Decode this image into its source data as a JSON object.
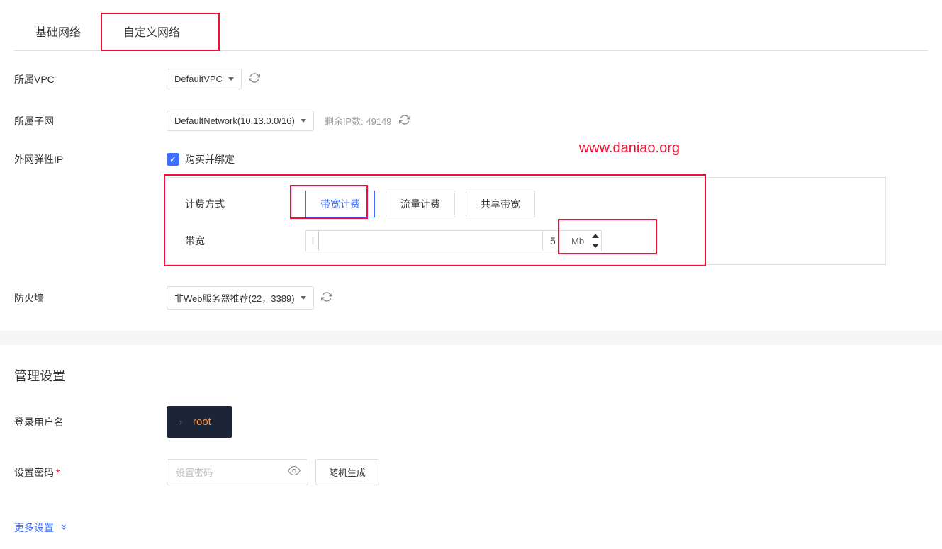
{
  "tabs": {
    "basic": "基础网络",
    "custom": "自定义网络"
  },
  "vpc": {
    "label": "所属VPC",
    "value": "DefaultVPC"
  },
  "subnet": {
    "label": "所属子网",
    "value": "DefaultNetwork(10.13.0.0/16)",
    "remaining_label": "剩余IP数:",
    "remaining_value": "49149"
  },
  "eip": {
    "label": "外网弹性IP",
    "checked_label": "购买并绑定"
  },
  "watermark": "www.daniao.org",
  "billing": {
    "method_label": "计费方式",
    "options": {
      "bandwidth": "带宽计费",
      "traffic": "流量计费",
      "shared": "共享带宽"
    },
    "bandwidth_label": "带宽",
    "bandwidth_value": "5",
    "bandwidth_unit": "Mb"
  },
  "firewall": {
    "label": "防火墙",
    "value": "非Web服务器推荐(22，3389)"
  },
  "management": {
    "title": "管理设置",
    "username_label": "登录用户名",
    "username_value": "root",
    "password_label": "设置密码",
    "password_placeholder": "设置密码",
    "random_button": "随机生成"
  },
  "more_settings": "更多设置"
}
